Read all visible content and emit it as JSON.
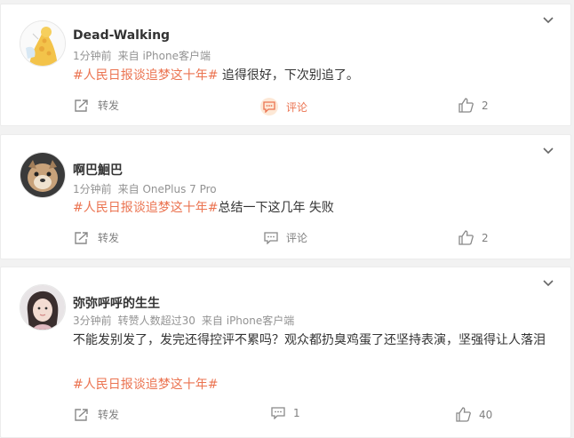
{
  "posts": [
    {
      "username": "Dead-Walking",
      "time": "1分钟前",
      "source": "来自 iPhone客户端",
      "extra": "",
      "topic": "#人民日报谈追梦这十年#",
      "text": " 追得很好，下次别追了。",
      "text2": "",
      "actions": {
        "repost": "转发",
        "comment": "评论",
        "like": "2"
      },
      "comment_active": true,
      "avatar": "giraffe-avatar"
    },
    {
      "username": "啊巴鮰巴",
      "time": "1分钟前",
      "source": "来自 OnePlus 7 Pro",
      "extra": "",
      "topic": "#人民日报谈追梦这十年#",
      "text": "总结一下这几年 失败",
      "text2": "",
      "actions": {
        "repost": "转发",
        "comment": "评论",
        "like": "2"
      },
      "comment_active": false,
      "avatar": "dog-avatar"
    },
    {
      "username": "弥弥呼呼的生生",
      "time": "3分钟前",
      "source": "来自 iPhone客户端",
      "extra": "转赞人数超过30",
      "topic": "",
      "text": "不能发别发了，发完还得控评不累吗？观众都扔臭鸡蛋了还坚持表演，坚强得让人落泪",
      "text2": "#人民日报谈追梦这十年#",
      "actions": {
        "repost": "转发",
        "comment": "1",
        "like": "40"
      },
      "comment_active": false,
      "avatar": "person-avatar"
    }
  ],
  "colors": {
    "topic": "#eb7350",
    "meta": "#939393",
    "action": "#808080"
  }
}
